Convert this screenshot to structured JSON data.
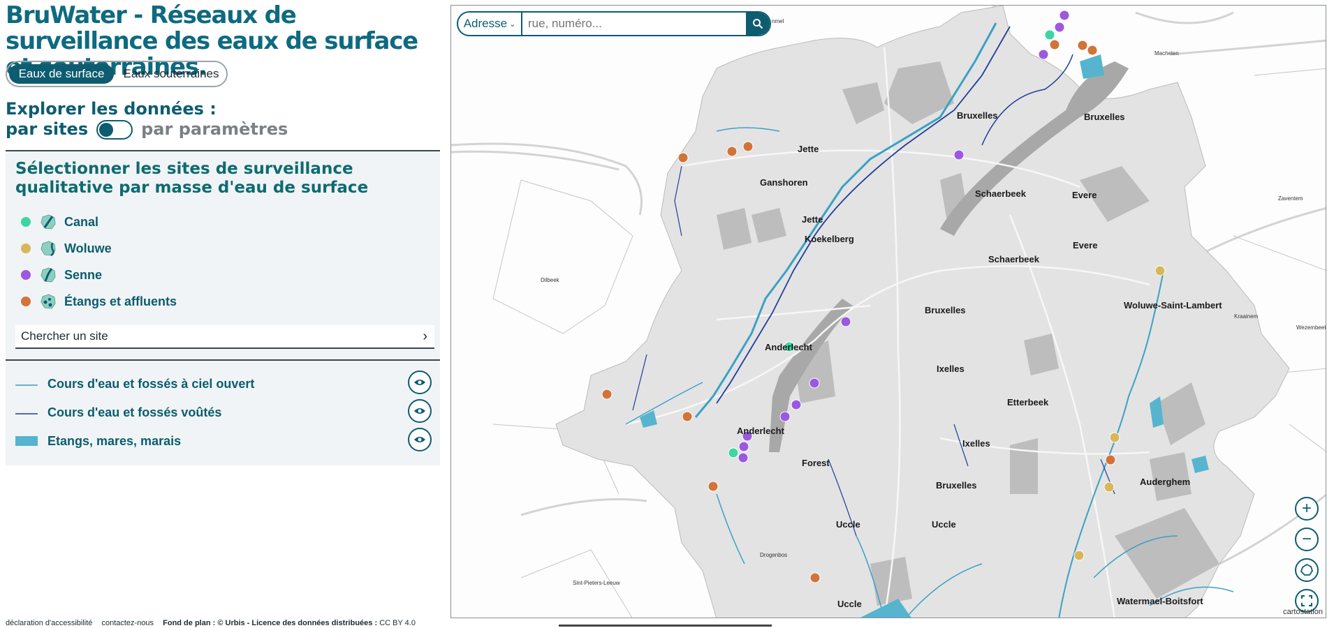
{
  "app": {
    "title": "BruWater - Réseaux de surveillance des eaux de surface et souterraines."
  },
  "tabs": [
    {
      "label": "Eaux de surface",
      "active": true
    },
    {
      "label": "Eaux souterraines",
      "active": false
    }
  ],
  "explore": {
    "heading": "Explorer les données :",
    "left_option": "par sites",
    "right_option": "par paramètres",
    "toggle_state": "par sites"
  },
  "selection": {
    "heading": "Sélectionner les sites de surveillance qualitative par masse d'eau de surface",
    "items": [
      {
        "label": "Canal",
        "color": "#3dd6a3",
        "icon": "canal-map-icon"
      },
      {
        "label": "Woluwe",
        "color": "#d8b65a",
        "icon": "woluwe-map-icon"
      },
      {
        "label": "Senne",
        "color": "#9b59e0",
        "icon": "senne-map-icon"
      },
      {
        "label": "Étangs et affluents",
        "color": "#d2733a",
        "icon": "etangs-map-icon"
      }
    ],
    "search_placeholder": "Chercher un site"
  },
  "layers": [
    {
      "label": "Cours d'eau et fossés à ciel ouvert",
      "symbol": "light-blue-line",
      "color": "#3a9fc7"
    },
    {
      "label": "Cours d'eau et fossés voûtés",
      "symbol": "dark-blue-line",
      "color": "#1f3d9a"
    },
    {
      "label": "Etangs, mares, marais",
      "symbol": "blue-fill",
      "color": "#56b4cf"
    }
  ],
  "footer": {
    "accessibility": "déclaration d'accessibilité",
    "contact": "contactez-nous",
    "basemap_prefix": "Fond de plan : © Urbis - Licence des données distribuées :",
    "license": "CC BY 4.0"
  },
  "map": {
    "address_select": "Adresse",
    "address_placeholder": "rue, numéro...",
    "attribution": "cartostation",
    "place_labels": [
      "Bruxelles",
      "Bruxelles",
      "Jette",
      "Ganshoren",
      "Jette",
      "Koekelberg",
      "Schaerbeek",
      "Evere",
      "Evere",
      "Schaerbeek",
      "Woluwe-Saint-Lambert",
      "Bruxelles",
      "Anderlecht",
      "Ixelles",
      "Etterbeek",
      "Anderlecht",
      "Ixelles",
      "Forest",
      "Auderghem",
      "Bruxelles",
      "Uccle",
      "Uccle",
      "Uccle",
      "Watermael-Boitsfort"
    ],
    "small_labels": [
      "Machelen",
      "Zaventem",
      "Dilbeek",
      "Kraainem",
      "Wezembeek",
      "Drogenbos",
      "Sint-Pieters-Leeuw",
      "nmel"
    ]
  }
}
